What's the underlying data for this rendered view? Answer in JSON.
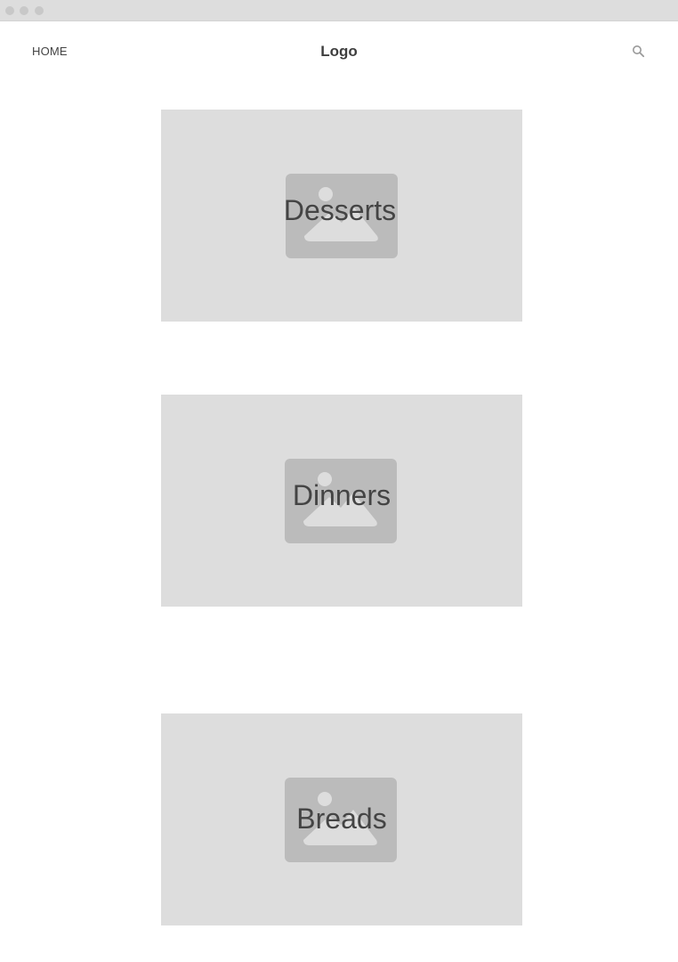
{
  "nav": {
    "home_label": "HOME",
    "logo_text": "Logo",
    "search_icon": "search-icon"
  },
  "categories": [
    {
      "label": "Desserts",
      "icon": "image-placeholder-icon"
    },
    {
      "label": "Dinners",
      "icon": "image-placeholder-icon"
    },
    {
      "label": "Breads",
      "icon": "image-placeholder-icon"
    }
  ],
  "colors": {
    "titlebar": "#dddddd",
    "card_background": "#dddddd",
    "placeholder_fill": "#bbbbbb",
    "placeholder_shape": "#dddddd",
    "text": "#444444"
  }
}
